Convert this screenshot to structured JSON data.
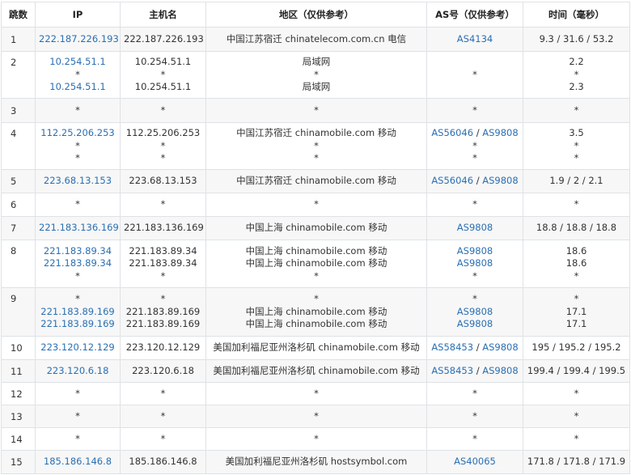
{
  "headers": {
    "hop": "跳数",
    "ip": "IP",
    "host": "主机名",
    "region": "地区（仅供参考）",
    "as": "AS号（仅供参考）",
    "time": "时间（毫秒）"
  },
  "rows": [
    {
      "hop": "1",
      "height": 30,
      "lines": [
        {
          "ip": "222.187.226.193",
          "host": "222.187.226.193",
          "region": "中国江苏宿迁 chinatelecom.com.cn 电信",
          "as": [
            [
              "AS4134"
            ]
          ],
          "time": "9.3 / 31.6 / 53.2"
        }
      ]
    },
    {
      "hop": "2",
      "height": 58,
      "lines": [
        {
          "ip": "10.254.51.1",
          "host": "10.254.51.1",
          "region": "局域网",
          "as": [],
          "time": "2.2"
        },
        {
          "ip": "*",
          "host": "*",
          "region": "*",
          "as": "*",
          "time": "*"
        },
        {
          "ip": "10.254.51.1",
          "host": "10.254.51.1",
          "region": "局域网",
          "as": [],
          "time": "2.3"
        }
      ]
    },
    {
      "hop": "3",
      "height": 30,
      "lines": [
        {
          "ip": "*",
          "host": "*",
          "region": "*",
          "as": "*",
          "time": "*"
        }
      ]
    },
    {
      "hop": "4",
      "height": 58,
      "lines": [
        {
          "ip": "112.25.206.253",
          "host": "112.25.206.253",
          "region": "中国江苏宿迁 chinamobile.com 移动",
          "as": [
            [
              "AS56046",
              "AS9808"
            ]
          ],
          "time": "3.5"
        },
        {
          "ip": "*",
          "host": "*",
          "region": "*",
          "as": "*",
          "time": "*"
        },
        {
          "ip": "*",
          "host": "*",
          "region": "*",
          "as": "*",
          "time": "*"
        }
      ]
    },
    {
      "hop": "5",
      "height": 29,
      "lines": [
        {
          "ip": "223.68.13.153",
          "host": "223.68.13.153",
          "region": "中国江苏宿迁 chinamobile.com 移动",
          "as": [
            [
              "AS56046",
              "AS9808"
            ]
          ],
          "time": "1.9 / 2 / 2.1"
        }
      ]
    },
    {
      "hop": "6",
      "height": 29,
      "lines": [
        {
          "ip": "*",
          "host": "*",
          "region": "*",
          "as": "*",
          "time": "*"
        }
      ]
    },
    {
      "hop": "7",
      "height": 29,
      "lines": [
        {
          "ip": "221.183.136.169",
          "host": "221.183.136.169",
          "region": "中国上海 chinamobile.com 移动",
          "as": [
            [
              "AS9808"
            ]
          ],
          "time": "18.8 / 18.8 / 18.8"
        }
      ]
    },
    {
      "hop": "8",
      "height": 59,
      "lines": [
        {
          "ip": "221.183.89.34",
          "host": "221.183.89.34",
          "region": "中国上海 chinamobile.com 移动",
          "as": [
            [
              "AS9808"
            ]
          ],
          "time": "18.6"
        },
        {
          "ip": "221.183.89.34",
          "host": "221.183.89.34",
          "region": "中国上海 chinamobile.com 移动",
          "as": [
            [
              "AS9808"
            ]
          ],
          "time": "18.6"
        },
        {
          "ip": "*",
          "host": "*",
          "region": "*",
          "as": "*",
          "time": "*"
        }
      ]
    },
    {
      "hop": "9",
      "height": 60,
      "lines": [
        {
          "ip": "*",
          "host": "*",
          "region": "*",
          "as": "*",
          "time": "*"
        },
        {
          "ip": "221.183.89.169",
          "host": "221.183.89.169",
          "region": "中国上海 chinamobile.com 移动",
          "as": [
            [
              "AS9808"
            ]
          ],
          "time": "17.1"
        },
        {
          "ip": "221.183.89.169",
          "host": "221.183.89.169",
          "region": "中国上海 chinamobile.com 移动",
          "as": [
            [
              "AS9808"
            ]
          ],
          "time": "17.1"
        }
      ]
    },
    {
      "hop": "10",
      "height": 29,
      "lines": [
        {
          "ip": "223.120.12.129",
          "host": "223.120.12.129",
          "region": "美国加利福尼亚州洛杉矶 chinamobile.com 移动",
          "as": [
            [
              "AS58453",
              "AS9808"
            ]
          ],
          "time": "195 / 195.2 / 195.2"
        }
      ]
    },
    {
      "hop": "11",
      "height": 28,
      "lines": [
        {
          "ip": "223.120.6.18",
          "host": "223.120.6.18",
          "region": "美国加利福尼亚州洛杉矶 chinamobile.com 移动",
          "as": [
            [
              "AS58453",
              "AS9808"
            ]
          ],
          "time": "199.4 / 199.4 / 199.5"
        }
      ]
    },
    {
      "hop": "12",
      "height": 28,
      "lines": [
        {
          "ip": "*",
          "host": "*",
          "region": "*",
          "as": "*",
          "time": "*"
        }
      ]
    },
    {
      "hop": "13",
      "height": 28,
      "lines": [
        {
          "ip": "*",
          "host": "*",
          "region": "*",
          "as": "*",
          "time": "*"
        }
      ]
    },
    {
      "hop": "14",
      "height": 28,
      "lines": [
        {
          "ip": "*",
          "host": "*",
          "region": "*",
          "as": "*",
          "time": "*"
        }
      ]
    },
    {
      "hop": "15",
      "height": 29,
      "lines": [
        {
          "ip": "185.186.146.8",
          "host": "185.186.146.8",
          "region": "美国加利福尼亚州洛杉矶 hostsymbol.com",
          "as": [
            [
              "AS40065"
            ]
          ],
          "time": "171.8 / 171.8 / 171.9"
        }
      ]
    }
  ]
}
